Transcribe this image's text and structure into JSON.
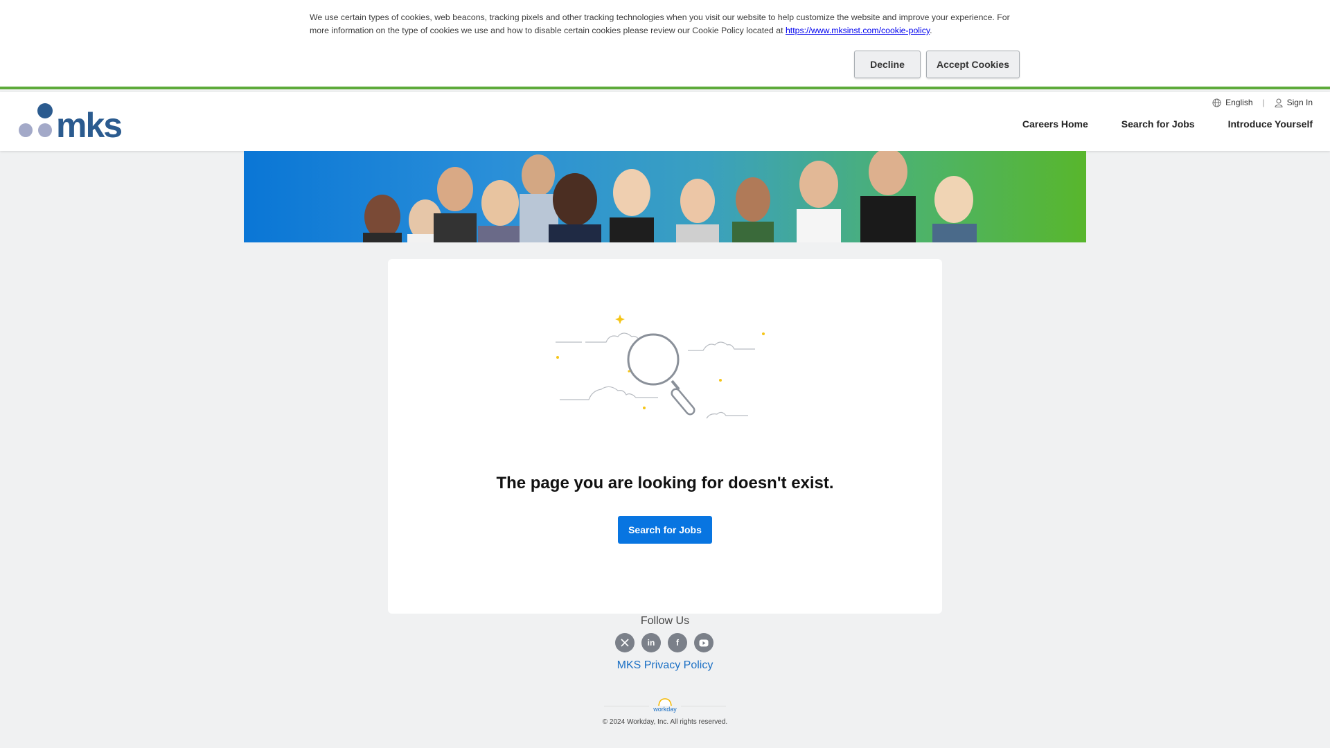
{
  "cookie_banner": {
    "text_part1": "We use certain types of cookies, web beacons, tracking pixels and other tracking technologies when you visit our website to help customize the website and improve your experience. For more information on the type of cookies we use and how to disable certain cookies please review our Cookie Policy located at ",
    "link_text": "https://www.mksinst.com/cookie-policy",
    "text_part2": ".",
    "decline_label": "Decline",
    "accept_label": "Accept Cookies"
  },
  "header": {
    "logo_text": "mks",
    "language": "English",
    "sign_in": "Sign In",
    "nav": [
      "Careers Home",
      "Search for Jobs",
      "Introduce Yourself"
    ]
  },
  "main": {
    "message": "The page you are looking for doesn't exist.",
    "search_button": "Search for Jobs"
  },
  "footer": {
    "follow_us": "Follow Us",
    "socials": [
      "x-icon",
      "linkedin-icon",
      "facebook-icon",
      "youtube-icon"
    ],
    "privacy_link": "MKS Privacy Policy",
    "workday_logo_text": "workday",
    "copyright": "© 2024 Workday, Inc. All rights reserved."
  },
  "colors": {
    "accent_green": "#5daa3a",
    "primary_blue": "#0875e1",
    "logo_blue": "#2b5b8f",
    "logo_gray": "#a3a9c8"
  }
}
